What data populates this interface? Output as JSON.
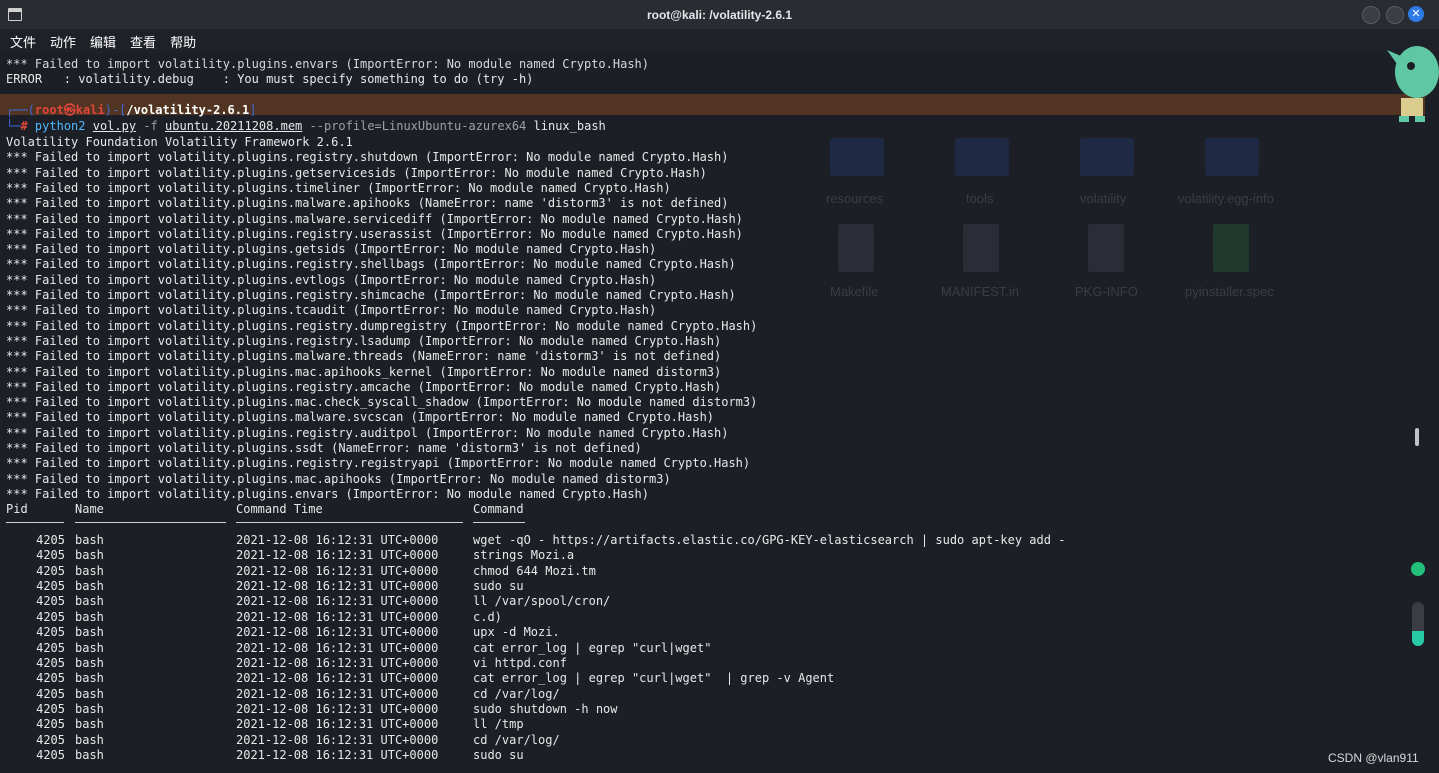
{
  "window": {
    "title": "root@kali: /volatility-2.6.1"
  },
  "menu": [
    "文件",
    "动作",
    "编辑",
    "查看",
    "帮助"
  ],
  "pre_lines": [
    "*** Failed to import volatility.plugins.envars (ImportError: No module named Crypto.Hash)",
    "ERROR   : volatility.debug    : You must specify something to do (try -h)"
  ],
  "prompt": {
    "user": "root㉿kali",
    "path": "/volatility-2.6.1",
    "hash": "#",
    "cmd_py": "python2",
    "cmd_script": "vol.py",
    "cmd_flag": "-f",
    "cmd_file": "ubuntu.20211208.mem",
    "cmd_profile": "--profile=LinuxUbuntu-azurex64",
    "cmd_plugin": "linux_bash"
  },
  "output_lines": [
    "Volatility Foundation Volatility Framework 2.6.1",
    "*** Failed to import volatility.plugins.registry.shutdown (ImportError: No module named Crypto.Hash)",
    "*** Failed to import volatility.plugins.getservicesids (ImportError: No module named Crypto.Hash)",
    "*** Failed to import volatility.plugins.timeliner (ImportError: No module named Crypto.Hash)",
    "*** Failed to import volatility.plugins.malware.apihooks (NameError: name 'distorm3' is not defined)",
    "*** Failed to import volatility.plugins.malware.servicediff (ImportError: No module named Crypto.Hash)",
    "*** Failed to import volatility.plugins.registry.userassist (ImportError: No module named Crypto.Hash)",
    "*** Failed to import volatility.plugins.getsids (ImportError: No module named Crypto.Hash)",
    "*** Failed to import volatility.plugins.registry.shellbags (ImportError: No module named Crypto.Hash)",
    "*** Failed to import volatility.plugins.evtlogs (ImportError: No module named Crypto.Hash)",
    "*** Failed to import volatility.plugins.registry.shimcache (ImportError: No module named Crypto.Hash)",
    "*** Failed to import volatility.plugins.tcaudit (ImportError: No module named Crypto.Hash)",
    "*** Failed to import volatility.plugins.registry.dumpregistry (ImportError: No module named Crypto.Hash)",
    "*** Failed to import volatility.plugins.registry.lsadump (ImportError: No module named Crypto.Hash)",
    "*** Failed to import volatility.plugins.malware.threads (NameError: name 'distorm3' is not defined)",
    "*** Failed to import volatility.plugins.mac.apihooks_kernel (ImportError: No module named distorm3)",
    "*** Failed to import volatility.plugins.registry.amcache (ImportError: No module named Crypto.Hash)",
    "*** Failed to import volatility.plugins.mac.check_syscall_shadow (ImportError: No module named distorm3)",
    "*** Failed to import volatility.plugins.malware.svcscan (ImportError: No module named Crypto.Hash)",
    "*** Failed to import volatility.plugins.registry.auditpol (ImportError: No module named Crypto.Hash)",
    "*** Failed to import volatility.plugins.ssdt (NameError: name 'distorm3' is not defined)",
    "*** Failed to import volatility.plugins.registry.registryapi (ImportError: No module named Crypto.Hash)",
    "*** Failed to import volatility.plugins.mac.apihooks (ImportError: No module named distorm3)",
    "*** Failed to import volatility.plugins.envars (ImportError: No module named Crypto.Hash)"
  ],
  "table": {
    "headers": [
      "Pid",
      "Name",
      "Command Time",
      "Command"
    ],
    "rows": [
      [
        "4205",
        "bash",
        "2021-12-08 16:12:31 UTC+0000",
        "wget -qO - https://artifacts.elastic.co/GPG-KEY-elasticsearch | sudo apt-key add -"
      ],
      [
        "4205",
        "bash",
        "2021-12-08 16:12:31 UTC+0000",
        "strings Mozi.a"
      ],
      [
        "4205",
        "bash",
        "2021-12-08 16:12:31 UTC+0000",
        "chmod 644 Mozi.tm"
      ],
      [
        "4205",
        "bash",
        "2021-12-08 16:12:31 UTC+0000",
        "sudo su"
      ],
      [
        "4205",
        "bash",
        "2021-12-08 16:12:31 UTC+0000",
        "ll /var/spool/cron/"
      ],
      [
        "4205",
        "bash",
        "2021-12-08 16:12:31 UTC+0000",
        "c.d)"
      ],
      [
        "4205",
        "bash",
        "2021-12-08 16:12:31 UTC+0000",
        "upx -d Mozi."
      ],
      [
        "4205",
        "bash",
        "2021-12-08 16:12:31 UTC+0000",
        "cat error_log | egrep \"curl|wget\""
      ],
      [
        "4205",
        "bash",
        "2021-12-08 16:12:31 UTC+0000",
        "vi httpd.conf"
      ],
      [
        "4205",
        "bash",
        "2021-12-08 16:12:31 UTC+0000",
        "cat error_log | egrep \"curl|wget\"  | grep -v Agent"
      ],
      [
        "4205",
        "bash",
        "2021-12-08 16:12:31 UTC+0000",
        "cd /var/log/"
      ],
      [
        "4205",
        "bash",
        "2021-12-08 16:12:31 UTC+0000",
        "sudo shutdown -h now"
      ],
      [
        "4205",
        "bash",
        "2021-12-08 16:12:31 UTC+0000",
        "ll /tmp"
      ],
      [
        "4205",
        "bash",
        "2021-12-08 16:12:31 UTC+0000",
        "cd /var/log/"
      ],
      [
        "4205",
        "bash",
        "2021-12-08 16:12:31 UTC+0000",
        "sudo su"
      ]
    ]
  },
  "background_ghosts": {
    "labels": [
      "resources",
      "tools",
      "volatility",
      "volatility.egg-info",
      "Makefile",
      "MANIFEST.in",
      "PKG-INFO",
      "pyinstaller.spec"
    ]
  },
  "side_widget": {
    "level": 0.35
  },
  "watermark": "CSDN @vlan911",
  "colors": {
    "terminal_bg": "#1d1f26",
    "prompt_frame": "#3f6ad8",
    "prompt_root": "#e0463c",
    "python": "#4db8ff",
    "accent_green": "#22c07a"
  }
}
